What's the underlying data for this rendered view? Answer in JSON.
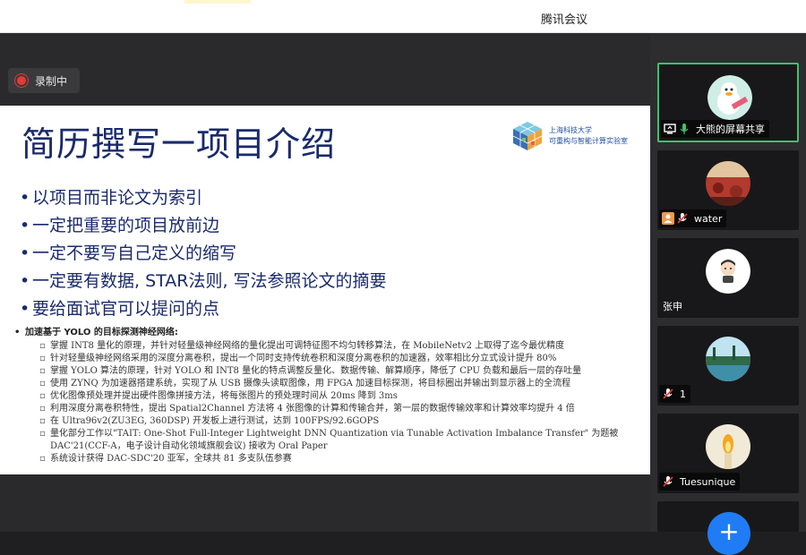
{
  "app": {
    "title": "腾讯会议"
  },
  "recording": {
    "label": "录制中",
    "status_color": "#e53935"
  },
  "slide": {
    "title": "简历撰写一项目介绍",
    "logo": {
      "line1": "上海科技大学",
      "line2": "可重构与智能计算实验室"
    },
    "bullets": [
      "以项目而非论文为索引",
      "一定把重要的项目放前边",
      "一定不要写自己定义的缩写",
      "一定要有数据, STAR法则, 写法参照论文的摘要",
      "要给面试官可以提问的点"
    ],
    "subheading": "加速基于 YOLO 的目标探测神经网络:",
    "details": [
      "掌握 INT8 量化的原理，并针对轻量级神经网络的量化提出可调特征图不均匀转移算法，在 MobileNetv2 上取得了迄今最优精度",
      "针对轻量级神经网络采用的深度分离卷积，提出一个同时支持传统卷积和深度分离卷积的加速器，效率相比分立式设计提升 80%",
      "掌握 YOLO 算法的原理，针对 YOLO 和 INT8 量化的特点调整反量化、数据传输、解算顺序，降低了 CPU 负载和最后一层的存吐量",
      "使用 ZYNQ 为加速器搭建系统，实现了从 USB 摄像头读取图像，用 FPGA 加速目标探测，将目标圈出并输出到显示器上的全流程",
      "优化图像预处理并提出硬件图像拼接方法，将每张图片的预处理时间从 20ms 降到 3ms",
      "利用深度分离卷积特性，提出 Spatial2Channel 方法将 4 张图像的计算和传输合并，第一层的数据传输效率和计算效率均提升 4 倍",
      "在 Ultra96v2(ZU3EG, 360DSP) 开发板上进行测试，达到 100FPS/92.6GOPS",
      "量化部分工作以\"TAIT: One-Shot Full-Integer Lightweight DNN Quantization via Tunable Activation Imbalance Transfer\" 为题被",
      "DAC'21(CCF-A，电子设计自动化领域旗舰会议) 接收为 Oral Paper",
      "系统设计获得 DAC-SDC'20 亚军，全球共 81 多支队伍参赛"
    ]
  },
  "participants": [
    {
      "name": "大熊的屏幕共享",
      "icons": [
        "screen-share-icon",
        "mic-on-icon"
      ],
      "active": true
    },
    {
      "name": "water",
      "icons": [
        "avatar-badge-icon",
        "mic-muted-icon"
      ],
      "active": false
    },
    {
      "name": "张申",
      "icons": [],
      "active": false
    },
    {
      "name": "1",
      "icons": [
        "mic-muted-icon"
      ],
      "active": false
    },
    {
      "name": "Tuesunique",
      "icons": [
        "mic-muted-icon"
      ],
      "active": false
    }
  ],
  "add_button": {
    "label": "+"
  },
  "colors": {
    "accent": "#1f7cf5",
    "active_border": "#3cc36a",
    "slide_title": "#1a2a6c",
    "background": "#1f1f21"
  }
}
